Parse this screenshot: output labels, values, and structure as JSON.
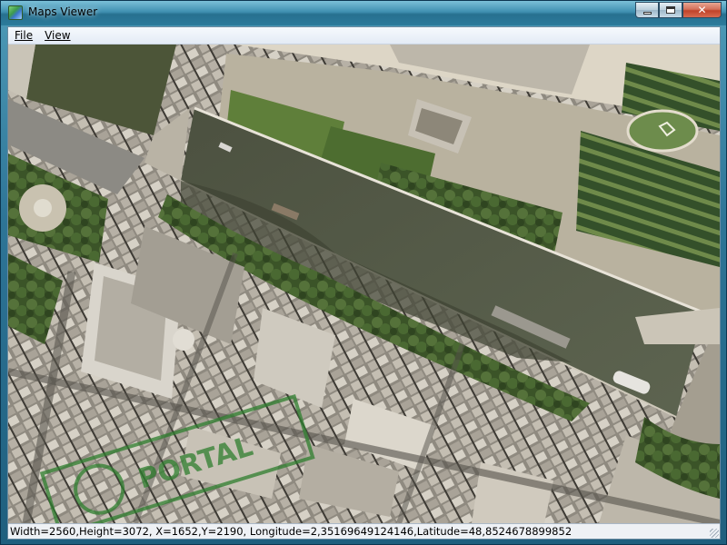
{
  "window": {
    "title": "Maps Viewer",
    "close_glyph": "✕"
  },
  "icons": {
    "app": "map-app-icon",
    "minimize": "minimize-icon",
    "maximize": "maximize-icon",
    "close": "close-icon"
  },
  "menu": {
    "file": "File",
    "view": "View"
  },
  "map": {
    "watermark_text": "PORTAL"
  },
  "status": {
    "text": "Width=2560,Height=3072, X=1652,Y=2190, Longitude=2,35169649124146,Latitude=48,8524678899852"
  },
  "colors": {
    "river": "#575c47",
    "trees": "#3f5a2c",
    "roofs": "#b8b2a6",
    "quay": "#c9c3b4",
    "watermark": "#2f7f2f"
  }
}
